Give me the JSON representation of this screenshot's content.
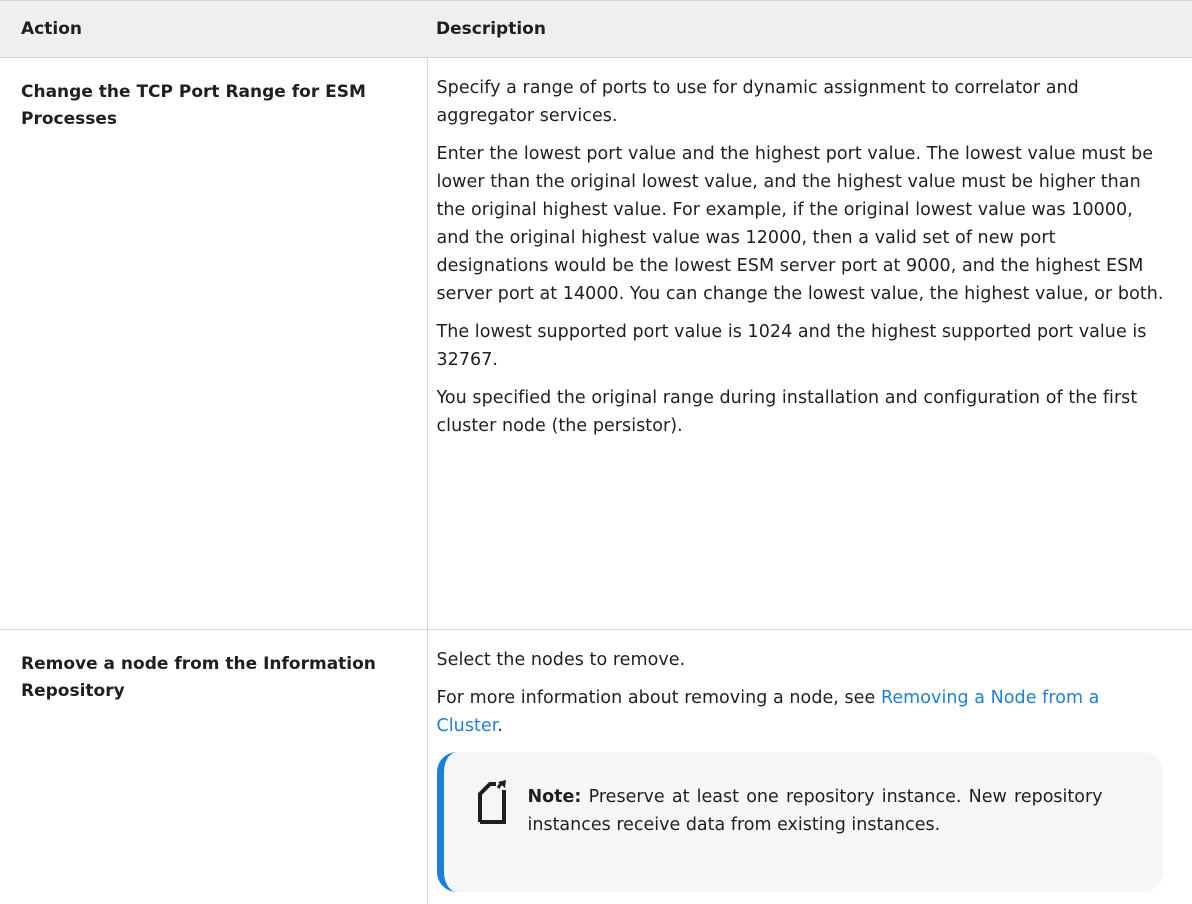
{
  "table": {
    "headers": {
      "action": "Action",
      "description": "Description"
    },
    "rows": [
      {
        "action": "Change the TCP Port Range for ESM Processes",
        "paragraphs": [
          "Specify a range of ports to use for dynamic assignment to correlator and aggregator services.",
          "Enter the lowest port value and the highest port value. The lowest value must be lower than the original lowest value, and the highest value must be higher than the original highest value. For example, if the original lowest value was 10000, and the original highest value was 12000, then a valid set of new port designations would be the lowest ESM server port at 9000, and the highest ESM server port at 14000. You can change the lowest value, the highest value, or both.",
          "The lowest supported port value is 1024 and the highest supported port value is 32767.",
          "You specified the original range during installation and configuration of the first cluster node (the persistor)."
        ]
      },
      {
        "action": "Remove a node from the Information Repository",
        "intro": "Select the nodes to remove.",
        "more_info_prefix": "For more information about removing a node, see ",
        "link_text": "Removing a Node from a Cluster",
        "more_info_suffix": ".",
        "note": {
          "icon": "note-icon",
          "label": "Note:",
          "text": " Preserve at least one repository instance. New repository instances receive data from existing instances."
        }
      }
    ]
  },
  "colors": {
    "header_bg": "#efefef",
    "link": "#1f7fd6",
    "note_bar": "#1a7fd8",
    "note_bg": "#f4f6f7"
  }
}
